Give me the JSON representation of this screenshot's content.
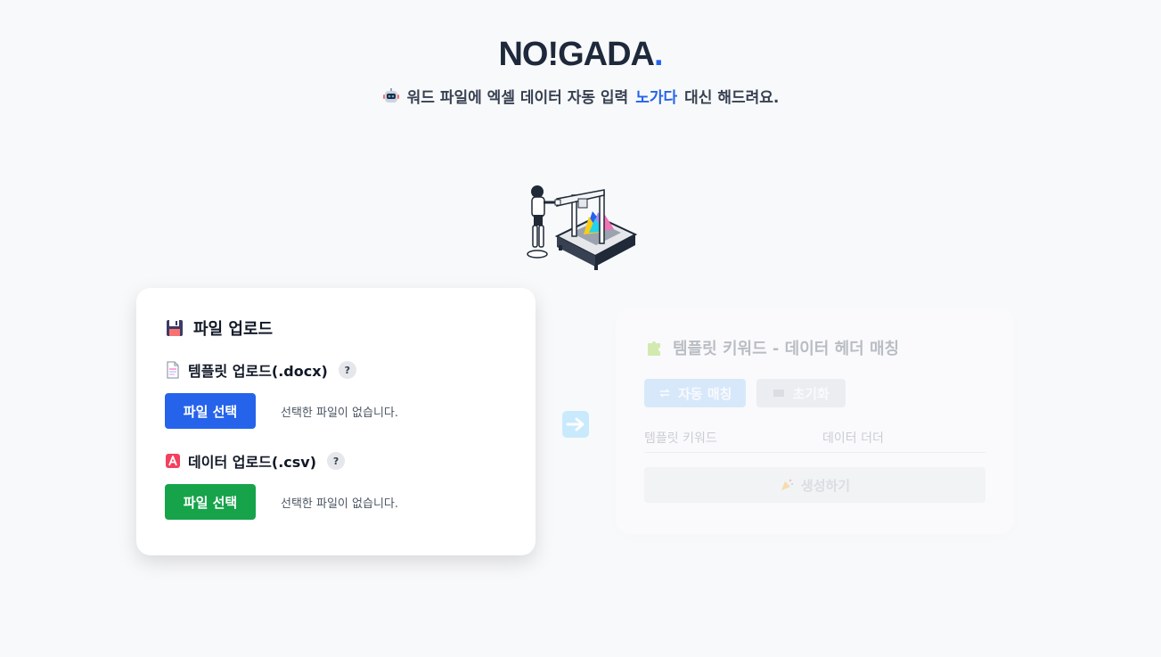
{
  "brand": {
    "name": "NO!GADA",
    "dot": ".",
    "accent": "#2563eb"
  },
  "tagline": {
    "icon": "robot-face-icon",
    "before": "워드 파일에 엑셀 데이터 자동 입력",
    "highlight": "노가다",
    "after": "대신 해드려요."
  },
  "illustration": {
    "icon": "robot-machine-illustration"
  },
  "upload": {
    "title": "파일 업로드",
    "title_icon": "floppy-disk-icon",
    "template": {
      "label": "템플릿 업로드(.docx)",
      "icon": "document-icon",
      "help": "?",
      "button": "파일 선택",
      "status": "선택한 파일이 없습니다.",
      "button_color": "#2563eb"
    },
    "data": {
      "label": "데이터 업로드(.csv)",
      "icon": "letter-a-icon",
      "help": "?",
      "button": "파일 선택",
      "status": "선택한 파일이 없습니다.",
      "button_color": "#16a34a"
    }
  },
  "arrow": {
    "icon": "right-arrow-icon"
  },
  "matching": {
    "title": "템플릿 키워드 - 데이터 헤더 매칭",
    "title_icon": "puzzle-icon",
    "auto_match": "자동 매칭",
    "reset": "초기화",
    "col_keyword": "템플릿 키워드",
    "col_header": "데이터 더더",
    "generate": "생성하기"
  }
}
